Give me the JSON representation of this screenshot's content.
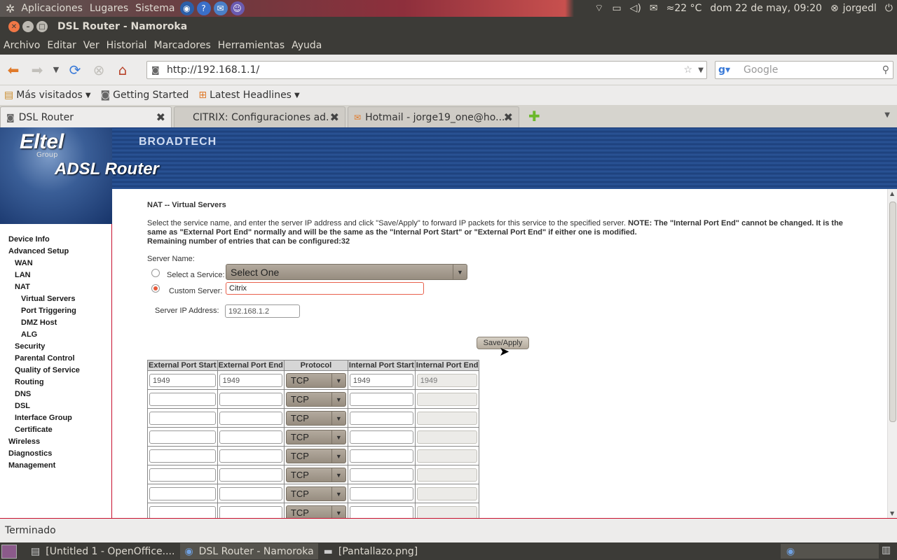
{
  "top_panel": {
    "menus": [
      "Aplicaciones",
      "Lugares",
      "Sistema"
    ],
    "weather": "≈22 °C",
    "clock": "dom 22 de may, 09:20",
    "user": "jorgedl"
  },
  "window": {
    "title": "DSL Router - Namoroka"
  },
  "menubar": [
    "Archivo",
    "Editar",
    "Ver",
    "Historial",
    "Marcadores",
    "Herramientas",
    "Ayuda"
  ],
  "navbar": {
    "url": "http://192.168.1.1/",
    "search_placeholder": "Google"
  },
  "bookmarks": [
    "Más visitados",
    "Getting Started",
    "Latest Headlines"
  ],
  "tabs": [
    {
      "label": "DSL Router"
    },
    {
      "label": "CITRIX: Configuraciones ad..."
    },
    {
      "label": "Hotmail - jorge19_one@ho..."
    }
  ],
  "brand": {
    "name": "Eltel",
    "group": "Group",
    "product": "ADSL Router",
    "partner": "BROADTECH"
  },
  "sidebar": {
    "items": [
      "Device Info",
      "Advanced Setup",
      "WAN",
      "LAN",
      "NAT",
      "Virtual Servers",
      "Port Triggering",
      "DMZ Host",
      "ALG",
      "Security",
      "Parental Control",
      "Quality of Service",
      "Routing",
      "DNS",
      "DSL",
      "Interface Group",
      "Certificate",
      "Wireless",
      "Diagnostics",
      "Management"
    ]
  },
  "main": {
    "heading": "NAT -- Virtual Servers",
    "intro": "Select the service name, and enter the server IP address and click \"Save/Apply\" to forward IP packets for this service to the specified server.",
    "note": "NOTE: The \"Internal Port End\" cannot be changed. It is the same as \"External Port End\" normally and will be the same as the \"Internal Port Start\" or \"External Port End\" if either one is modified.",
    "remaining": "Remaining number of entries that can be configured:32",
    "server_name_label": "Server Name:",
    "select_service_label": "Select a Service:",
    "select_service_value": "Select One",
    "custom_server_label": "Custom Server:",
    "custom_server_value": "Citrix",
    "server_ip_label": "Server IP Address:",
    "server_ip_value": "192.168.1.2",
    "save_label": "Save/Apply"
  },
  "port_table": {
    "headers": [
      "External Port Start",
      "External Port End",
      "Protocol",
      "Internal Port Start",
      "Internal Port End"
    ],
    "rows": [
      {
        "ext_start": "1949",
        "ext_end": "1949",
        "protocol": "TCP",
        "int_start": "1949",
        "int_end": "1949"
      },
      {
        "ext_start": "",
        "ext_end": "",
        "protocol": "TCP",
        "int_start": "",
        "int_end": ""
      },
      {
        "ext_start": "",
        "ext_end": "",
        "protocol": "TCP",
        "int_start": "",
        "int_end": ""
      },
      {
        "ext_start": "",
        "ext_end": "",
        "protocol": "TCP",
        "int_start": "",
        "int_end": ""
      },
      {
        "ext_start": "",
        "ext_end": "",
        "protocol": "TCP",
        "int_start": "",
        "int_end": ""
      },
      {
        "ext_start": "",
        "ext_end": "",
        "protocol": "TCP",
        "int_start": "",
        "int_end": ""
      },
      {
        "ext_start": "",
        "ext_end": "",
        "protocol": "TCP",
        "int_start": "",
        "int_end": ""
      },
      {
        "ext_start": "",
        "ext_end": "",
        "protocol": "TCP",
        "int_start": "",
        "int_end": ""
      }
    ]
  },
  "status": {
    "text": "Terminado"
  },
  "taskbar": [
    "[Untitled 1 - OpenOffice....",
    "DSL Router - Namoroka",
    "[Pantallazo.png]"
  ]
}
